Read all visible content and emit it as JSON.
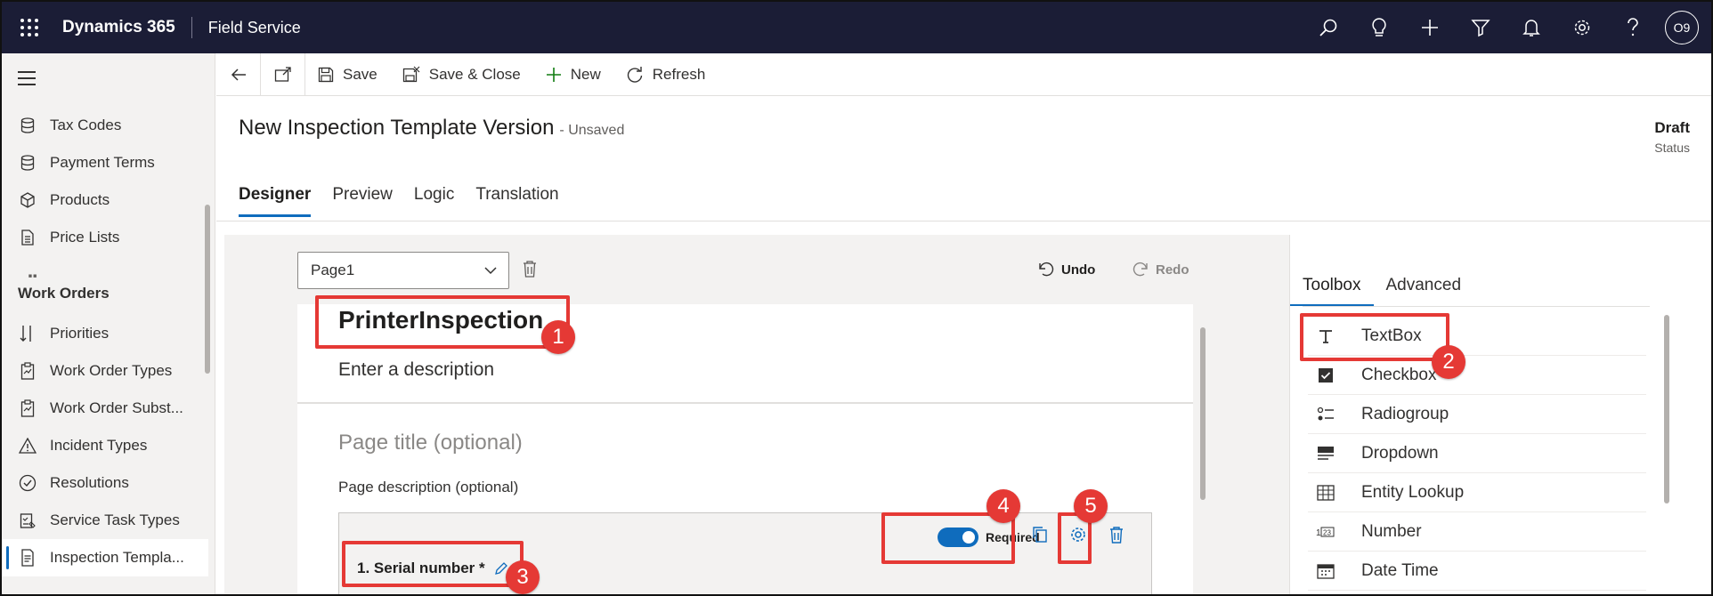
{
  "topbar": {
    "brand": "Dynamics 365",
    "app_name": "Field Service",
    "icons": [
      "search-icon",
      "lightbulb-icon",
      "plus-icon",
      "filter-icon",
      "bell-icon",
      "gear-icon",
      "help-icon"
    ],
    "avatar_initials": "O9"
  },
  "sidebar": {
    "items_top": [
      {
        "label": "Tax Codes",
        "icon": "database-icon"
      },
      {
        "label": "Payment Terms",
        "icon": "database-icon"
      },
      {
        "label": "Products",
        "icon": "cube-icon"
      },
      {
        "label": "Price Lists",
        "icon": "document-icon"
      }
    ],
    "section_heading": "Work Orders",
    "items_work_orders": [
      {
        "label": "Priorities",
        "icon": "sort-icon"
      },
      {
        "label": "Work Order Types",
        "icon": "clipboard-icon"
      },
      {
        "label": "Work Order Subst...",
        "icon": "clipboard-icon"
      },
      {
        "label": "Incident Types",
        "icon": "warning-icon"
      },
      {
        "label": "Resolutions",
        "icon": "check-circle-icon"
      },
      {
        "label": "Service Task Types",
        "icon": "task-icon"
      },
      {
        "label": "Inspection Templa...",
        "icon": "inspection-icon",
        "active": true
      }
    ]
  },
  "commandbar": {
    "save": "Save",
    "save_close": "Save & Close",
    "new": "New",
    "refresh": "Refresh"
  },
  "header": {
    "title": "New Inspection Template Version",
    "unsaved": "- Unsaved",
    "status_value": "Draft",
    "status_label": "Status"
  },
  "tabs": [
    "Designer",
    "Preview",
    "Logic",
    "Translation"
  ],
  "active_tab": "Designer",
  "designer": {
    "page_select": "Page1",
    "undo": "Undo",
    "redo": "Redo",
    "form_title": "PrinterInspection",
    "form_description": "Enter a description",
    "page_title_placeholder": "Page title (optional)",
    "page_description_placeholder": "Page description (optional)",
    "question_label": "1. Serial number *",
    "required_label": "Required",
    "required_on": true
  },
  "toolbox": {
    "tabs": [
      "Toolbox",
      "Advanced"
    ],
    "active_tab": "Toolbox",
    "items": [
      {
        "label": "TextBox",
        "icon": "text-icon"
      },
      {
        "label": "Checkbox",
        "icon": "checkbox-icon"
      },
      {
        "label": "Radiogroup",
        "icon": "radiogroup-icon"
      },
      {
        "label": "Dropdown",
        "icon": "dropdown-icon"
      },
      {
        "label": "Entity Lookup",
        "icon": "lookup-icon"
      },
      {
        "label": "Number",
        "icon": "number-icon"
      },
      {
        "label": "Date Time",
        "icon": "calendar-icon"
      }
    ]
  },
  "callouts": [
    "1",
    "2",
    "3",
    "4",
    "5"
  ],
  "colors": {
    "topbar_bg": "#1b1d36",
    "accent": "#0f6cbd",
    "callout_red": "#e53935"
  }
}
